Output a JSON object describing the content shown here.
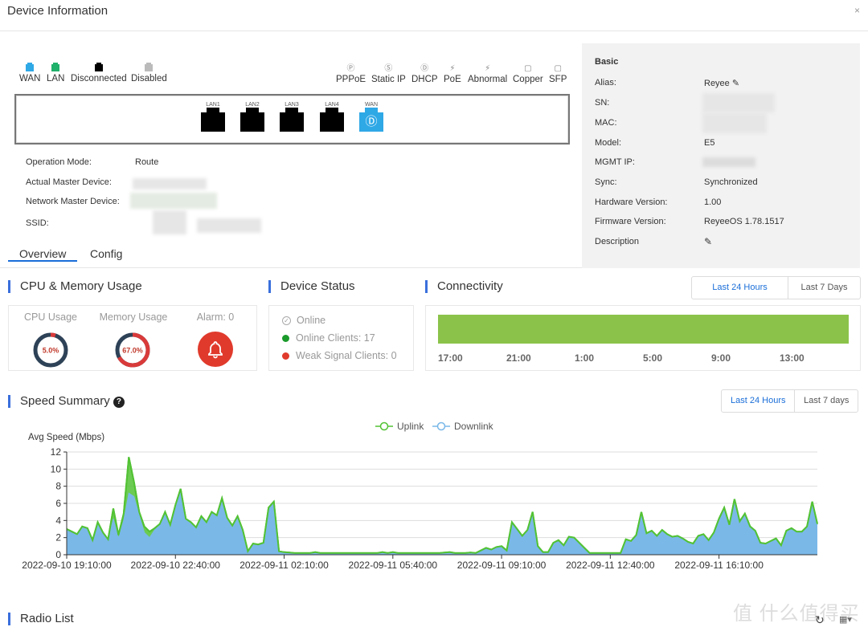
{
  "header": {
    "title": "Device Information",
    "close_icon": "×"
  },
  "port_legend": [
    {
      "label": "WAN",
      "color": "#2fa8e6"
    },
    {
      "label": "LAN",
      "color": "#1fb06a"
    },
    {
      "label": "Disconnected",
      "color": "#000000"
    },
    {
      "label": "Disabled",
      "color": "#bbbbbb"
    }
  ],
  "type_legend": [
    {
      "label": "PPPoE",
      "glyph": "Ⓟ"
    },
    {
      "label": "Static IP",
      "glyph": "Ⓢ"
    },
    {
      "label": "DHCP",
      "glyph": "Ⓓ"
    },
    {
      "label": "PoE",
      "glyph": "⚡"
    },
    {
      "label": "Abnormal",
      "glyph": "⚡"
    },
    {
      "label": "Copper",
      "glyph": "▢"
    },
    {
      "label": "SFP",
      "glyph": "▢"
    }
  ],
  "ports": [
    {
      "label": "LAN1",
      "state": "disconnected",
      "color": "#000000",
      "glyph": ""
    },
    {
      "label": "LAN2",
      "state": "disconnected",
      "color": "#000000",
      "glyph": ""
    },
    {
      "label": "LAN3",
      "state": "disconnected",
      "color": "#000000",
      "glyph": ""
    },
    {
      "label": "LAN4",
      "state": "disconnected",
      "color": "#000000",
      "glyph": ""
    },
    {
      "label": "WAN",
      "state": "wan-dhcp",
      "color": "#2fa8e6",
      "glyph": "Ⓓ"
    }
  ],
  "device_info": {
    "operation_mode_label": "Operation Mode:",
    "operation_mode_value": "Route",
    "actual_master_label": "Actual Master Device:",
    "network_master_label": "Network Master Device:",
    "ssid_label": "SSID:"
  },
  "basic": {
    "title": "Basic",
    "alias_label": "Alias:",
    "alias_value": "Reyee",
    "sn_label": "SN:",
    "mac_label": "MAC:",
    "model_label": "Model:",
    "model_value": "E5",
    "mgmt_ip_label": "MGMT IP:",
    "sync_label": "Sync:",
    "sync_value": "Synchronized",
    "hw_label": "Hardware Version:",
    "hw_value": "1.00",
    "fw_label": "Firmware Version:",
    "fw_value": "ReyeeOS 1.78.1517",
    "desc_label": "Description"
  },
  "tabs": [
    {
      "label": "Overview",
      "active": true
    },
    {
      "label": "Config",
      "active": false
    }
  ],
  "cpu_mem": {
    "title": "CPU & Memory Usage",
    "cpu_label": "CPU Usage",
    "cpu_value": "5.0%",
    "cpu_percent": 5.0,
    "mem_label": "Memory Usage",
    "mem_value": "67.0%",
    "mem_percent": 67.0,
    "alarm_label": "Alarm: 0",
    "colors": {
      "used": "#d93a3a",
      "free": "#2e4257",
      "alarm": "#e03a2c"
    }
  },
  "device_status": {
    "title": "Device Status",
    "online": "Online",
    "online_clients": "Online Clients: 17",
    "weak_clients": "Weak Signal Clients: 0",
    "colors": {
      "online": "#1a9a2a",
      "weak": "#e03a2c"
    }
  },
  "connectivity": {
    "title": "Connectivity",
    "range_buttons": [
      "Last 24 Hours",
      "Last 7 Days"
    ],
    "active_range": 0,
    "bar_color": "#8bc34a",
    "online_fraction": 1.0,
    "ticks": [
      "17:00",
      "21:00",
      "1:00",
      "5:00",
      "9:00",
      "13:00"
    ]
  },
  "speed": {
    "title": "Speed Summary",
    "help_icon": "?",
    "range_buttons": [
      "Last 24 Hours",
      "Last 7 days"
    ],
    "active_range": 0
  },
  "radio_list": {
    "title": "Radio List"
  },
  "watermark": "值 什么值得买",
  "chart_data": {
    "type": "area",
    "title": "",
    "ylabel": "Avg Speed (Mbps)",
    "xlabel": "",
    "ylim": [
      0,
      12
    ],
    "yticks": [
      0,
      2,
      4,
      6,
      8,
      10,
      12
    ],
    "xticks": [
      "2022-09-10 19:10:00",
      "2022-09-10 22:40:00",
      "2022-09-11 02:10:00",
      "2022-09-11 05:40:00",
      "2022-09-11 09:10:00",
      "2022-09-11 12:40:00",
      "2022-09-11 16:10:00"
    ],
    "xtick_index": [
      0,
      21,
      42,
      63,
      84,
      105,
      126
    ],
    "grid": true,
    "legend": "top-center",
    "interval_minutes": 10,
    "series": [
      {
        "name": "Uplink",
        "color": "#52c234",
        "values": [
          3.0,
          2.7,
          2.4,
          3.3,
          3.1,
          1.7,
          3.8,
          2.6,
          1.8,
          5.4,
          2.3,
          4.8,
          11.4,
          8.5,
          5.0,
          3.3,
          2.7,
          3.1,
          3.6,
          5.0,
          3.5,
          5.8,
          7.7,
          4.2,
          3.8,
          3.2,
          4.5,
          3.8,
          5.0,
          4.6,
          6.6,
          4.3,
          3.4,
          4.5,
          2.9,
          0.4,
          1.3,
          1.2,
          1.4,
          5.5,
          6.2,
          0.4,
          0.3,
          0.25,
          0.2,
          0.2,
          0.2,
          0.2,
          0.3,
          0.2,
          0.2,
          0.2,
          0.2,
          0.2,
          0.2,
          0.2,
          0.2,
          0.2,
          0.2,
          0.2,
          0.2,
          0.3,
          0.2,
          0.3,
          0.2,
          0.2,
          0.2,
          0.2,
          0.2,
          0.2,
          0.2,
          0.2,
          0.2,
          0.25,
          0.3,
          0.2,
          0.2,
          0.2,
          0.25,
          0.2,
          0.5,
          0.8,
          0.6,
          0.9,
          1.0,
          0.5,
          3.8,
          3.0,
          2.2,
          2.9,
          5.0,
          1.0,
          0.3,
          0.3,
          1.4,
          1.7,
          1.1,
          2.1,
          2.0,
          1.4,
          0.8,
          0.2,
          0.2,
          0.2,
          0.2,
          0.2,
          0.2,
          0.2,
          1.8,
          1.6,
          2.3,
          5.0,
          2.5,
          2.8,
          2.2,
          2.9,
          2.4,
          2.1,
          2.2,
          1.9,
          1.5,
          1.3,
          2.2,
          2.4,
          1.7,
          2.6,
          4.2,
          5.5,
          3.5,
          6.5,
          3.9,
          4.8,
          3.3,
          2.8,
          1.4,
          1.3,
          1.6,
          1.9,
          1.1,
          2.8,
          3.1,
          2.7,
          2.7,
          3.3,
          6.2,
          3.6
        ]
      },
      {
        "name": "Downlink",
        "color": "#7ab8e8",
        "values": [
          2.9,
          2.6,
          2.3,
          3.2,
          3.0,
          1.6,
          3.7,
          2.5,
          1.7,
          4.2,
          1.9,
          4.0,
          7.2,
          6.8,
          4.6,
          2.6,
          2.0,
          2.9,
          3.5,
          4.9,
          3.4,
          5.5,
          7.5,
          4.1,
          3.7,
          3.1,
          4.4,
          3.7,
          4.9,
          4.5,
          6.5,
          4.2,
          3.3,
          4.4,
          2.8,
          0.3,
          1.2,
          1.1,
          1.3,
          5.4,
          6.1,
          0.3,
          0.2,
          0.2,
          0.15,
          0.15,
          0.15,
          0.15,
          0.2,
          0.15,
          0.15,
          0.15,
          0.15,
          0.15,
          0.15,
          0.15,
          0.15,
          0.15,
          0.15,
          0.15,
          0.15,
          0.2,
          0.15,
          0.2,
          0.15,
          0.15,
          0.15,
          0.15,
          0.15,
          0.15,
          0.15,
          0.15,
          0.15,
          0.2,
          0.2,
          0.15,
          0.15,
          0.15,
          0.2,
          0.15,
          0.4,
          0.7,
          0.5,
          0.8,
          0.9,
          0.4,
          3.7,
          2.9,
          2.1,
          2.8,
          4.9,
          0.9,
          0.2,
          0.2,
          1.3,
          1.6,
          1.0,
          2.0,
          1.9,
          1.3,
          0.7,
          0.15,
          0.15,
          0.15,
          0.15,
          0.15,
          0.15,
          0.15,
          1.7,
          1.5,
          2.2,
          4.9,
          2.4,
          2.7,
          2.1,
          2.8,
          2.3,
          2.0,
          2.1,
          1.8,
          1.4,
          1.2,
          2.1,
          2.3,
          1.6,
          2.5,
          4.1,
          5.4,
          3.3,
          6.4,
          3.8,
          4.7,
          3.2,
          2.7,
          1.3,
          1.2,
          1.5,
          1.8,
          1.0,
          2.7,
          3.0,
          2.6,
          2.6,
          3.2,
          6.1,
          3.5
        ]
      }
    ]
  }
}
